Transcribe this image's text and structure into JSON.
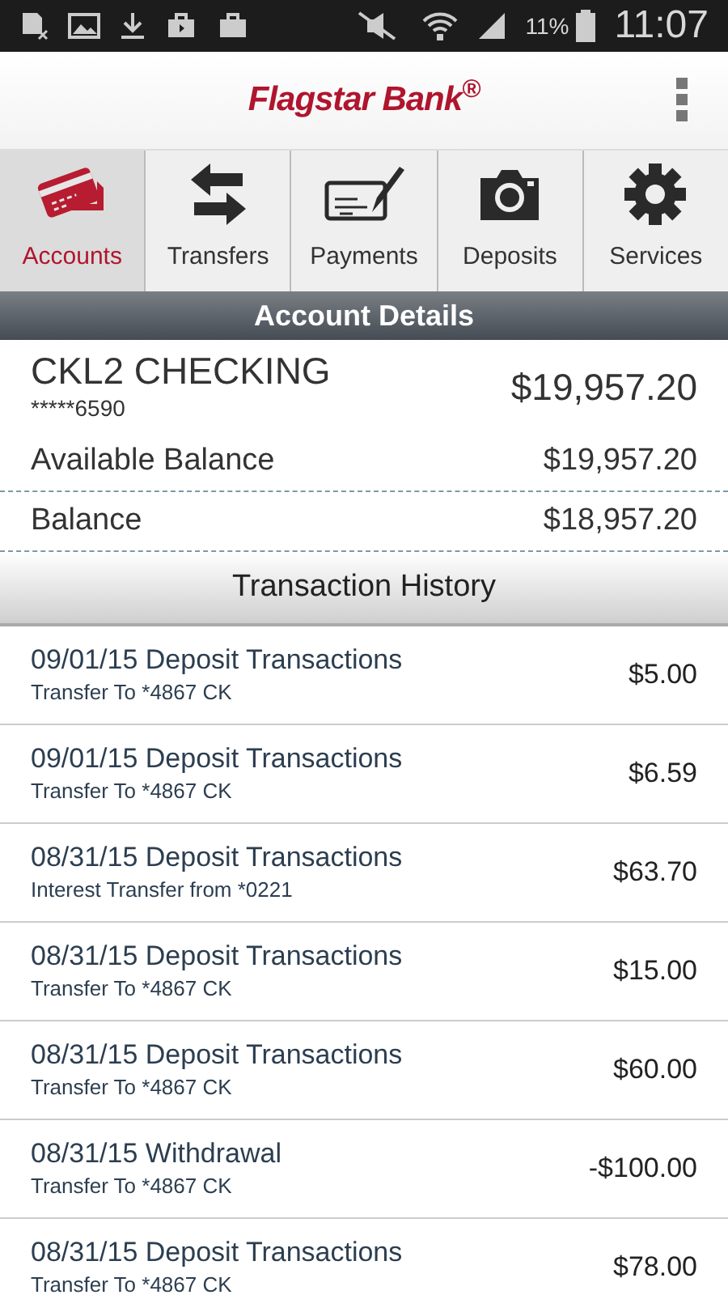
{
  "status_bar": {
    "battery": "11%",
    "time": "11:07"
  },
  "header": {
    "logo": "Flagstar Bank$^{®}$"
  },
  "tabs": [
    {
      "label": "Accounts",
      "kind": "card",
      "selected": true
    },
    {
      "label": "Transfers",
      "kind": "arrows",
      "selected": false
    },
    {
      "label": "Payments",
      "kind": "check",
      "selected": false
    },
    {
      "label": "Deposits",
      "kind": "camera",
      "selected": false
    },
    {
      "label": "Services",
      "kind": "gear",
      "selected": false
    }
  ],
  "section_title": "Account Details",
  "account": {
    "name": "CKL2 CHECKING",
    "number": "*****6590",
    "amount": "$19,957.20",
    "balances": [
      {
        "label": "Available Balance",
        "amount": "$19,957.20"
      },
      {
        "label": "Balance",
        "amount": "$18,957.20"
      }
    ]
  },
  "history_title": "Transaction History",
  "transactions": [
    {
      "title": "09/01/15 Deposit Transactions",
      "detail": "Transfer To *4867 CK",
      "amount": "$5.00"
    },
    {
      "title": "09/01/15 Deposit Transactions",
      "detail": "Transfer To *4867 CK",
      "amount": "$6.59"
    },
    {
      "title": "08/31/15 Deposit Transactions",
      "detail": "Interest Transfer from *0221",
      "amount": "$63.70"
    },
    {
      "title": "08/31/15 Deposit Transactions",
      "detail": "Transfer To *4867 CK",
      "amount": "$15.00"
    },
    {
      "title": "08/31/15 Deposit Transactions",
      "detail": "Transfer To *4867 CK",
      "amount": "$60.00"
    },
    {
      "title": "08/31/15 Withdrawal",
      "detail": "Transfer To *4867 CK",
      "amount": "-$100.00"
    },
    {
      "title": "08/31/15 Deposit Transactions",
      "detail": "Transfer To *4867 CK",
      "amount": "$78.00"
    }
  ]
}
